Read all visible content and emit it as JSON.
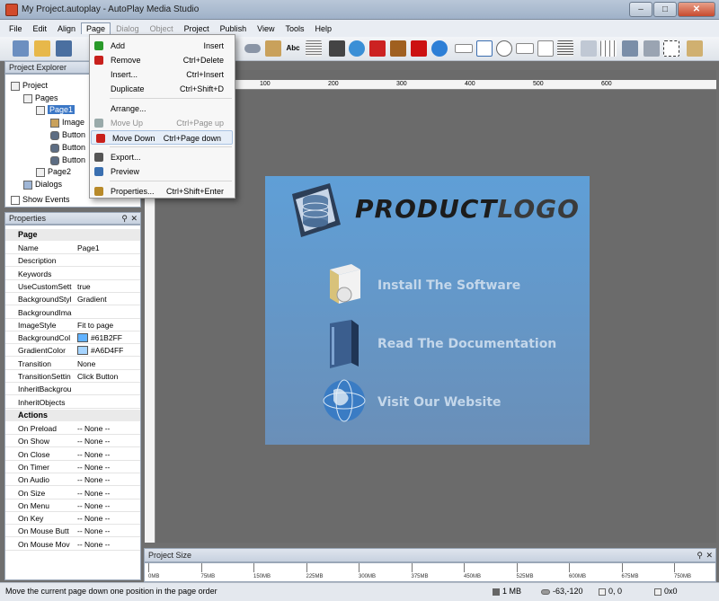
{
  "window": {
    "title": "My Project.autoplay - AutoPlay Media Studio"
  },
  "menubar": [
    "File",
    "Edit",
    "Align",
    "Page",
    "Dialog",
    "Object",
    "Project",
    "Publish",
    "View",
    "Tools",
    "Help"
  ],
  "page_menu": {
    "items": [
      {
        "label": "Add",
        "shortcut": "Insert",
        "icon": "add-icon"
      },
      {
        "label": "Remove",
        "shortcut": "Ctrl+Delete",
        "icon": "remove-icon"
      },
      {
        "label": "Insert...",
        "shortcut": "Ctrl+Insert",
        "icon": ""
      },
      {
        "label": "Duplicate",
        "shortcut": "Ctrl+Shift+D",
        "icon": ""
      },
      {
        "label": "Arrange...",
        "shortcut": "",
        "icon": ""
      },
      {
        "label": "Move Up",
        "shortcut": "Ctrl+Page up",
        "icon": "move-up-icon"
      },
      {
        "label": "Move Down",
        "shortcut": "Ctrl+Page down",
        "icon": "move-down-icon"
      },
      {
        "label": "Export...",
        "shortcut": "",
        "icon": "export-icon"
      },
      {
        "label": "Preview",
        "shortcut": "",
        "icon": "preview-icon"
      },
      {
        "label": "Properties...",
        "shortcut": "Ctrl+Shift+Enter",
        "icon": "properties-icon"
      }
    ]
  },
  "explorer": {
    "title": "Project Explorer",
    "tree": [
      "Project",
      "Pages",
      "Page1",
      "Image",
      "Button",
      "Button",
      "Button",
      "Page2",
      "Dialogs"
    ],
    "show_events": "Show Events"
  },
  "properties": {
    "title": "Properties",
    "page_section": "Page",
    "rows": [
      {
        "k": "Name",
        "v": "Page1"
      },
      {
        "k": "Description",
        "v": ""
      },
      {
        "k": "Keywords",
        "v": ""
      },
      {
        "k": "UseCustomSett",
        "v": "true"
      },
      {
        "k": "BackgroundStyl",
        "v": "Gradient"
      },
      {
        "k": "BackgroundIma",
        "v": ""
      },
      {
        "k": "ImageStyle",
        "v": "Fit to page"
      },
      {
        "k": "BackgroundCol",
        "v": "#61B2FF"
      },
      {
        "k": "GradientColor",
        "v": "#A6D4FF"
      },
      {
        "k": "Transition",
        "v": "None"
      },
      {
        "k": "TransitionSettin",
        "v": "Click Button"
      },
      {
        "k": "InheritBackgrou",
        "v": ""
      },
      {
        "k": "InheritObjects",
        "v": ""
      }
    ],
    "actions_section": "Actions",
    "actions": [
      {
        "k": "On Preload",
        "v": "-- None --"
      },
      {
        "k": "On Show",
        "v": "-- None --"
      },
      {
        "k": "On Close",
        "v": "-- None --"
      },
      {
        "k": "On Timer",
        "v": "-- None --"
      },
      {
        "k": "On Audio",
        "v": "-- None --"
      },
      {
        "k": "On Size",
        "v": "-- None --"
      },
      {
        "k": "On Menu",
        "v": "-- None --"
      },
      {
        "k": "On Key",
        "v": "-- None --"
      },
      {
        "k": "On Mouse Butt",
        "v": "-- None --"
      },
      {
        "k": "On Mouse Mov",
        "v": "-- None --"
      }
    ]
  },
  "ruler": [
    "100",
    "200",
    "300",
    "400",
    "500",
    "600"
  ],
  "page_preview": {
    "logo_dark": "PRODUCT",
    "logo_light": "LOGO",
    "links": [
      "Install The Software",
      "Read The Documentation",
      "Visit Our Website"
    ]
  },
  "project_size": {
    "title": "Project Size",
    "ticks": [
      "0MB",
      "75MB",
      "150MB",
      "225MB",
      "300MB",
      "375MB",
      "450MB",
      "525MB",
      "600MB",
      "675MB",
      "750MB"
    ]
  },
  "statusbar": {
    "message": "Move the current page down one position in the page order",
    "size": "1 MB",
    "coords": "-63,-120",
    "pos": "0, 0",
    "dims": "0x0"
  },
  "colors": {
    "bg_color": "#61B2FF",
    "gradient_color": "#A6D4FF"
  }
}
